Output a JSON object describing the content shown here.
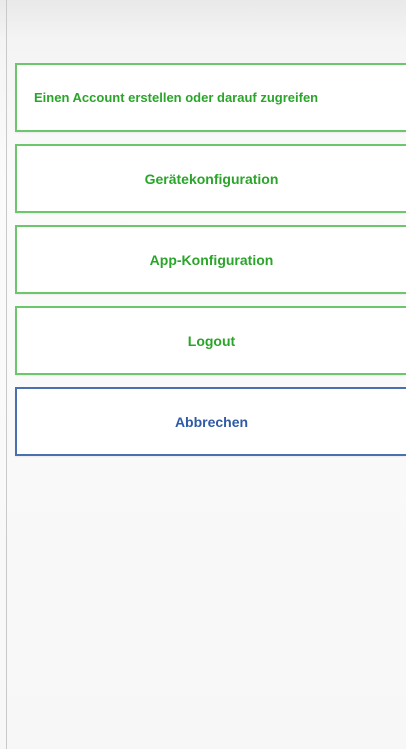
{
  "menu": {
    "items": [
      {
        "label": "Einen Account erstellen oder darauf zugreifen"
      },
      {
        "label": "Gerätekonfiguration"
      },
      {
        "label": "App-Konfiguration"
      },
      {
        "label": "Logout"
      }
    ],
    "cancel_label": "Abbrechen"
  },
  "colors": {
    "primary_border": "#6cc76c",
    "primary_text": "#2aa52a",
    "cancel_border": "#4a70b0",
    "cancel_text": "#2e5aa6"
  }
}
